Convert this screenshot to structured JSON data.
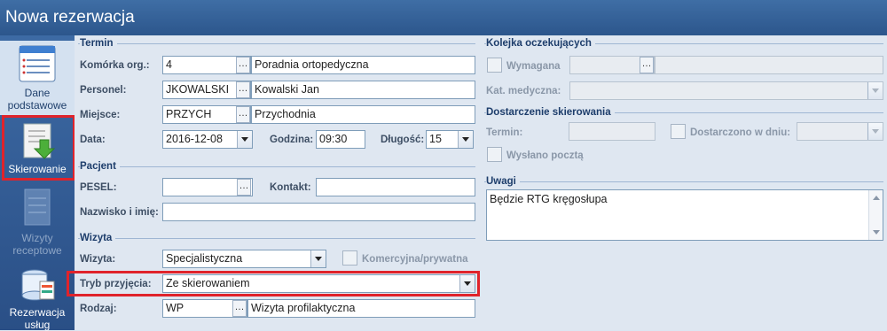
{
  "window": {
    "title": "Nowa rezerwacja"
  },
  "sidebar": {
    "items": [
      {
        "label_line1": "Dane",
        "label_line2": "podstawowe"
      },
      {
        "label_line1": "Skierowanie",
        "label_line2": ""
      },
      {
        "label_line1": "Wizyty",
        "label_line2": "receptowe"
      },
      {
        "label_line1": "Rezerwacja",
        "label_line2": "usług"
      }
    ]
  },
  "termin": {
    "title": "Termin",
    "komorka": {
      "label": "Komórka org.:",
      "code": "4",
      "name": "Poradnia ortopedyczna"
    },
    "personel": {
      "label": "Personel:",
      "code": "JKOWALSKI",
      "name": "Kowalski Jan"
    },
    "miejsce": {
      "label": "Miejsce:",
      "code": "PRZYCH",
      "name": "Przychodnia"
    },
    "data": {
      "label": "Data:",
      "value": "2016-12-08"
    },
    "godzina": {
      "label": "Godzina:",
      "value": "09:30"
    },
    "dlugosc": {
      "label": "Długość:",
      "value": "15"
    }
  },
  "pacjent": {
    "title": "Pacjent",
    "pesel": {
      "label": "PESEL:",
      "value": ""
    },
    "kontakt": {
      "label": "Kontakt:",
      "value": ""
    },
    "nazwisko": {
      "label": "Nazwisko i imię:",
      "value": ""
    }
  },
  "wizyta": {
    "title": "Wizyta",
    "wizyta": {
      "label": "Wizyta:",
      "value": "Specjalistyczna"
    },
    "komercyjna": {
      "label": "Komercyjna/prywatna",
      "checked": false
    },
    "tryb": {
      "label": "Tryb przyjęcia:",
      "value": "Ze skierowaniem"
    },
    "rodzaj": {
      "label": "Rodzaj:",
      "code": "WP",
      "name": "Wizyta profilaktyczna"
    }
  },
  "kolejka": {
    "title": "Kolejka oczekujących",
    "wymagana": {
      "label": "Wymagana",
      "checked": false
    },
    "kat_medyczna": {
      "label": "Kat. medyczna:",
      "value": ""
    }
  },
  "dostarczenie": {
    "title": "Dostarczenie skierowania",
    "termin": {
      "label": "Termin:",
      "value": ""
    },
    "dostarczono": {
      "label": "Dostarczono w dniu:",
      "checked": false
    },
    "wyslano": {
      "label": "Wysłano pocztą",
      "checked": false
    }
  },
  "uwagi": {
    "title": "Uwagi",
    "value": "Będzie RTG kręgosłupa"
  },
  "colors": {
    "highlight": "#e0232b",
    "titlebar": "#3f6ea5",
    "background": "#dfe7f1"
  },
  "icons": [
    "form-icon",
    "referral-download-icon",
    "prescription-icon",
    "services-database-icon"
  ]
}
